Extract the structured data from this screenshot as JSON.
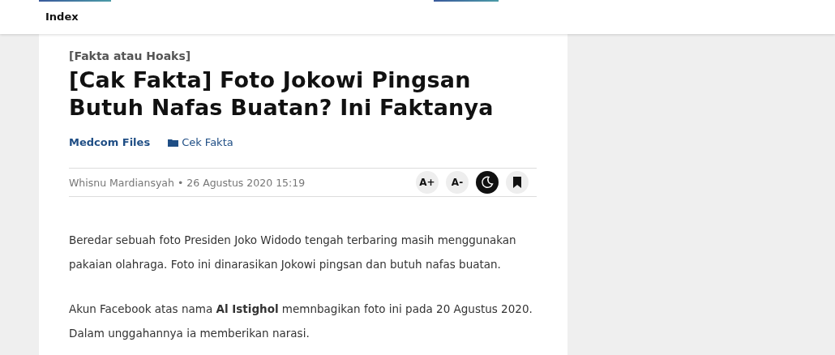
{
  "nav": {
    "label": "Index"
  },
  "article": {
    "category": "[Fakta atau Hoaks]",
    "title": "[Cak Fakta] Foto Jokowi Pingsan Butuh Nafas Buatan? Ini Faktanya",
    "source": "Medcom Files",
    "section": "Cek Fakta",
    "byline": "Whisnu Mardiansyah • 26 Agustus 2020 15:19",
    "tools": [
      {
        "kind": "text",
        "label": "A+",
        "on": false
      },
      {
        "kind": "text",
        "label": "A-",
        "on": false
      },
      {
        "kind": "moon",
        "on": true
      },
      {
        "kind": "bookmark",
        "on": false
      }
    ],
    "paragraphs": [
      "Beredar sebuah foto Presiden Joko Widodo tengah terbaring masih menggunakan pakaian olahraga. Foto ini dinarasikan Jokowi pingsan dan butuh nafas buatan.",
      "Akun Facebook atas nama **Al Istighol** memnbagikan foto ini pada 20 Agustus 2020. Dalam unggahannya ia memberikan narasi."
    ]
  }
}
